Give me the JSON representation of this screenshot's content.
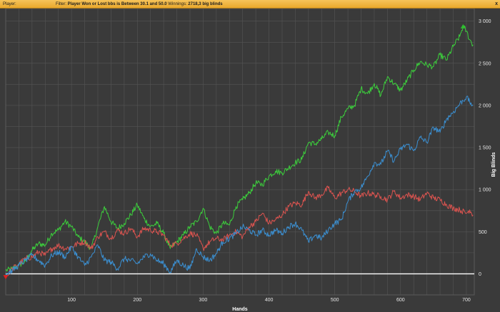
{
  "header": {
    "player_label": "Player:",
    "filter_label": "Filter:",
    "filter_text": "Player Won or Lost bbs is Between 30.1 and 50.0",
    "winnings_label": "Winnings:",
    "winnings_value": "2718,3 big blinds",
    "close_label": "x"
  },
  "chart_data": {
    "type": "line",
    "xlabel": "Hands",
    "ylabel": "Big Blinds",
    "xlim": [
      0,
      712
    ],
    "ylim": [
      -250,
      3150
    ],
    "x_ticks": [
      100,
      200,
      300,
      400,
      500,
      600,
      700
    ],
    "y_ticks": [
      {
        "value": 0,
        "label": "0"
      },
      {
        "value": 500,
        "label": "500"
      },
      {
        "value": 1000,
        "label": "1 000"
      },
      {
        "value": 1500,
        "label": "1 500"
      },
      {
        "value": 2000,
        "label": "2 000"
      },
      {
        "value": 2500,
        "label": "2 500"
      },
      {
        "value": 3000,
        "label": "3 000"
      }
    ],
    "grid": true,
    "series": [
      {
        "color": "#3ccd3c",
        "x": [
          0,
          10,
          20,
          30,
          40,
          50,
          60,
          70,
          80,
          90,
          100,
          110,
          120,
          130,
          140,
          150,
          160,
          170,
          180,
          190,
          200,
          210,
          220,
          230,
          240,
          250,
          260,
          270,
          280,
          290,
          300,
          310,
          320,
          330,
          340,
          350,
          360,
          370,
          380,
          390,
          400,
          410,
          420,
          430,
          440,
          450,
          460,
          470,
          480,
          490,
          500,
          510,
          520,
          530,
          540,
          550,
          560,
          570,
          580,
          590,
          600,
          610,
          620,
          630,
          640,
          650,
          660,
          670,
          680,
          690,
          695,
          700,
          705,
          710
        ],
        "values": [
          40,
          60,
          100,
          150,
          280,
          360,
          340,
          480,
          520,
          620,
          560,
          440,
          380,
          300,
          560,
          800,
          620,
          540,
          600,
          700,
          820,
          660,
          560,
          600,
          480,
          300,
          380,
          460,
          560,
          620,
          780,
          560,
          480,
          600,
          580,
          800,
          880,
          960,
          1080,
          1060,
          1160,
          1220,
          1200,
          1260,
          1320,
          1360,
          1560,
          1540,
          1600,
          1680,
          1640,
          1860,
          1960,
          2000,
          2200,
          2140,
          2260,
          2120,
          2340,
          2260,
          2180,
          2300,
          2420,
          2520,
          2480,
          2460,
          2600,
          2540,
          2700,
          2820,
          2940,
          2880,
          2780,
          2720
        ]
      },
      {
        "color": "#d9534f",
        "x": [
          0,
          10,
          20,
          30,
          40,
          50,
          60,
          70,
          80,
          90,
          100,
          110,
          120,
          130,
          140,
          150,
          160,
          170,
          180,
          190,
          200,
          210,
          220,
          230,
          240,
          250,
          260,
          270,
          280,
          290,
          300,
          310,
          320,
          330,
          340,
          350,
          360,
          370,
          380,
          390,
          400,
          410,
          420,
          430,
          440,
          450,
          460,
          470,
          480,
          490,
          500,
          510,
          520,
          530,
          540,
          550,
          560,
          570,
          580,
          590,
          600,
          610,
          620,
          630,
          640,
          650,
          660,
          670,
          680,
          690,
          700,
          705,
          710
        ],
        "values": [
          -40,
          60,
          120,
          180,
          200,
          260,
          220,
          300,
          340,
          300,
          320,
          360,
          380,
          300,
          440,
          500,
          420,
          520,
          480,
          540,
          440,
          540,
          520,
          500,
          460,
          340,
          360,
          420,
          480,
          460,
          300,
          380,
          420,
          400,
          460,
          500,
          440,
          560,
          620,
          720,
          600,
          640,
          700,
          800,
          840,
          820,
          980,
          900,
          940,
          1020,
          900,
          960,
          1000,
          980,
          920,
          960,
          940,
          920,
          880,
          980,
          900,
          940,
          920,
          880,
          960,
          900,
          880,
          820,
          780,
          760,
          720,
          760,
          700
        ]
      },
      {
        "color": "#3b8fd1",
        "x": [
          0,
          10,
          20,
          30,
          40,
          50,
          60,
          70,
          80,
          90,
          100,
          110,
          120,
          130,
          140,
          150,
          160,
          170,
          180,
          190,
          200,
          210,
          220,
          230,
          240,
          250,
          260,
          270,
          280,
          290,
          300,
          310,
          320,
          330,
          340,
          350,
          360,
          370,
          380,
          390,
          400,
          410,
          420,
          430,
          440,
          450,
          460,
          470,
          480,
          490,
          500,
          510,
          520,
          530,
          540,
          550,
          560,
          570,
          580,
          590,
          600,
          610,
          620,
          630,
          640,
          650,
          660,
          670,
          680,
          690,
          700,
          705,
          710
        ],
        "values": [
          0,
          40,
          100,
          160,
          220,
          160,
          100,
          220,
          260,
          200,
          320,
          200,
          100,
          200,
          340,
          160,
          140,
          60,
          180,
          160,
          120,
          200,
          240,
          160,
          120,
          20,
          160,
          100,
          60,
          300,
          200,
          160,
          240,
          380,
          420,
          480,
          560,
          520,
          460,
          520,
          460,
          520,
          480,
          560,
          600,
          520,
          380,
          460,
          420,
          520,
          600,
          640,
          860,
          980,
          1020,
          1160,
          1320,
          1300,
          1460,
          1340,
          1480,
          1540,
          1460,
          1620,
          1560,
          1740,
          1680,
          1840,
          1920,
          2020,
          2100,
          2040,
          2000
        ]
      }
    ],
    "zero_line_color": "#ffffff",
    "start_marker_color": "#e02020",
    "end_marker_color": "#2fbf2f",
    "background_color": "#3a3a3a",
    "grid_color": "#555555"
  }
}
